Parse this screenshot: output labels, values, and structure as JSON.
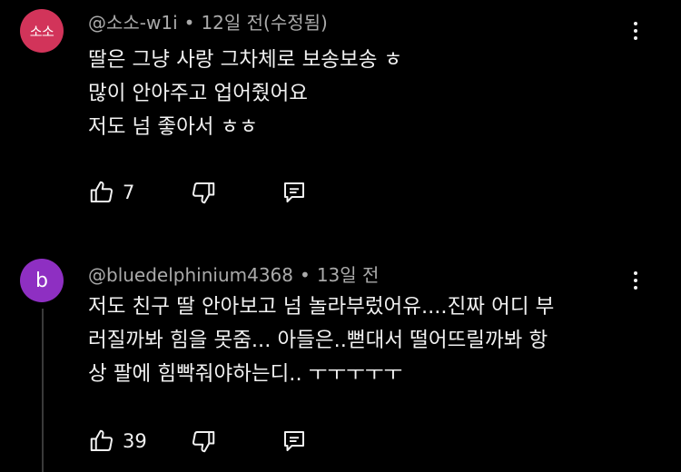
{
  "comments": [
    {
      "avatar_text": "소소",
      "avatar_color": "#d2345a",
      "author": "@소소-w1i",
      "time": "12일 전(수정됨)",
      "body": "딸은 그냥 사랑 그차체로 보송보송 ㅎ\n많이 안아주고 업어줬어요\n저도 넘 좋아서 ㅎㅎ",
      "likes": "7",
      "icons": {
        "like": "thumbs-up-icon",
        "dislike": "thumbs-down-icon",
        "reply": "reply-icon",
        "more": "more-vert-icon"
      }
    },
    {
      "avatar_text": "b",
      "avatar_color": "#8e2fc2",
      "author": "@bluedelphinium4368",
      "time": "13일 전",
      "body": "저도 친구 딸 안아보고 넘 놀라부렀어유....진짜 어디 부\n러질까봐 힘을 못줌... 아들은..뻗대서 떨어뜨릴까봐 항\n상 팔에 힘빡줘야하는디.. ㅜㅜㅜㅜㅜ",
      "likes": "39",
      "icons": {
        "like": "thumbs-up-icon",
        "dislike": "thumbs-down-icon",
        "reply": "reply-icon",
        "more": "more-vert-icon"
      }
    }
  ]
}
